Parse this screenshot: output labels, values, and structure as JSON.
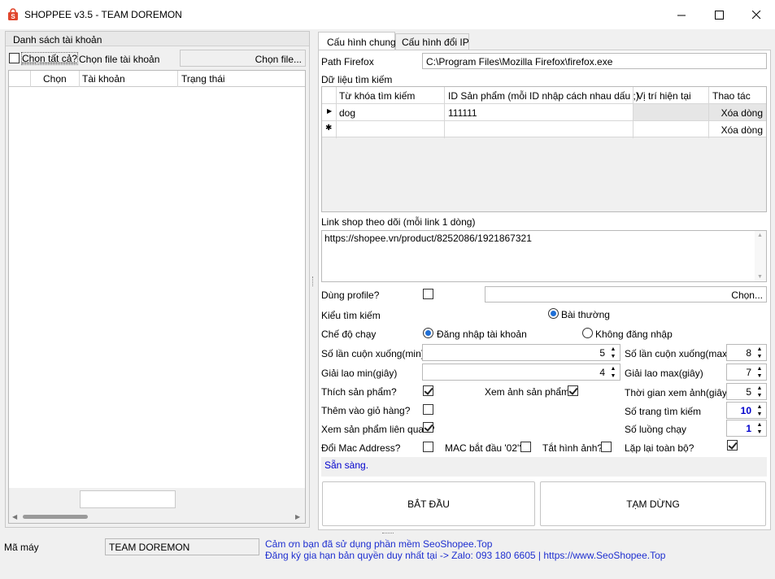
{
  "window": {
    "title": "SHOPPEE v3.5 - TEAM DOREMON",
    "minimize": "—",
    "maximize": "☐",
    "close": "✕"
  },
  "accounts": {
    "group_title": "Danh sách tài khoản",
    "select_all": "Chọn tất cả?",
    "select_file_label": "Chọn file tài khoản",
    "choose_file_button": "Chọn file...",
    "columns": [
      "Chọn",
      "Tài khoản",
      "Trạng thái"
    ]
  },
  "tabs": [
    {
      "label": "Cấu hình chung",
      "active": true
    },
    {
      "label": "Cấu hình đổi IP",
      "active": false
    }
  ],
  "config": {
    "path_firefox_label": "Path Firefox",
    "path_firefox_value": "C:\\Program Files\\Mozilla Firefox\\firefox.exe",
    "search_data_label": "Dữ liệu tìm kiếm",
    "search_columns": [
      "Từ khóa tìm kiếm",
      "ID Sản phẩm (mỗi ID nhập cách nhau dấu ;)",
      "Vị trí hiện tại",
      "Thao tác"
    ],
    "search_rows": [
      {
        "keyword": "dog",
        "product_id": "111111",
        "position": "",
        "action": "Xóa dòng"
      },
      {
        "keyword": "",
        "product_id": "",
        "position": "",
        "action": "Xóa dòng"
      }
    ],
    "shop_link_label": "Link shop theo dõi (mỗi link 1 dòng)",
    "shop_link_value": "https://shopee.vn/product/8252086/1921867321",
    "use_profile_label": "Dùng profile?",
    "use_profile_checked": false,
    "choose_profile_button": "Chọn...",
    "search_type_label": "Kiểu tìm kiếm",
    "search_type_option": "Bài thường",
    "run_mode_label": "Chế độ chạy",
    "run_mode_login": "Đăng nhập tài khoản",
    "run_mode_nologin": "Không đăng nhập",
    "scroll_min_label": "Số lần cuộn xuống(min)",
    "scroll_min_value": "5",
    "scroll_max_label": "Số lần cuộn xuống(max)",
    "scroll_max_value": "8",
    "rest_min_label": "Giải lao min(giây)",
    "rest_min_value": "4",
    "rest_max_label": "Giải lao max(giây)",
    "rest_max_value": "7",
    "like_label": "Thích sản phẩm?",
    "view_image_label": "Xem ảnh sản phẩm?",
    "view_image_time_label": "Thời gian xem ảnh(giây)",
    "view_image_time_value": "5",
    "add_cart_label": "Thêm vào giỏ hàng?",
    "pages_label": "Số trang tìm kiếm",
    "pages_value": "10",
    "related_label": "Xem sản phẩm liên quan?",
    "threads_label": "Số luồng chạy",
    "threads_value": "1",
    "mac_label": "Đổi Mac Address?",
    "mac02_label": "MAC bắt đầu '02'?",
    "hide_images_label": "Tắt hình ảnh?",
    "repeat_label": "Lặp lại toàn bộ?",
    "status_text": "Sẵn sàng.",
    "start_button": "BẮT ĐẦU",
    "pause_button": "TẠM DỪNG"
  },
  "footer": {
    "machine_label": "Mã máy",
    "machine_value": "TEAM DOREMON",
    "thanks_text": "Cảm ơn bạn đã sử dụng phần mềm SeoShopee.Top",
    "register_text": "Đăng ký gia hạn bản quyền duy nhất tại -> Zalo: 093 180 6605 | https://www.SeoShopee.Top"
  },
  "colors": {
    "accent_blue": "#1f6fd6",
    "link_blue": "#1e2fd0",
    "status_blue": "#0000cc",
    "icon_red": "#e0452b"
  }
}
